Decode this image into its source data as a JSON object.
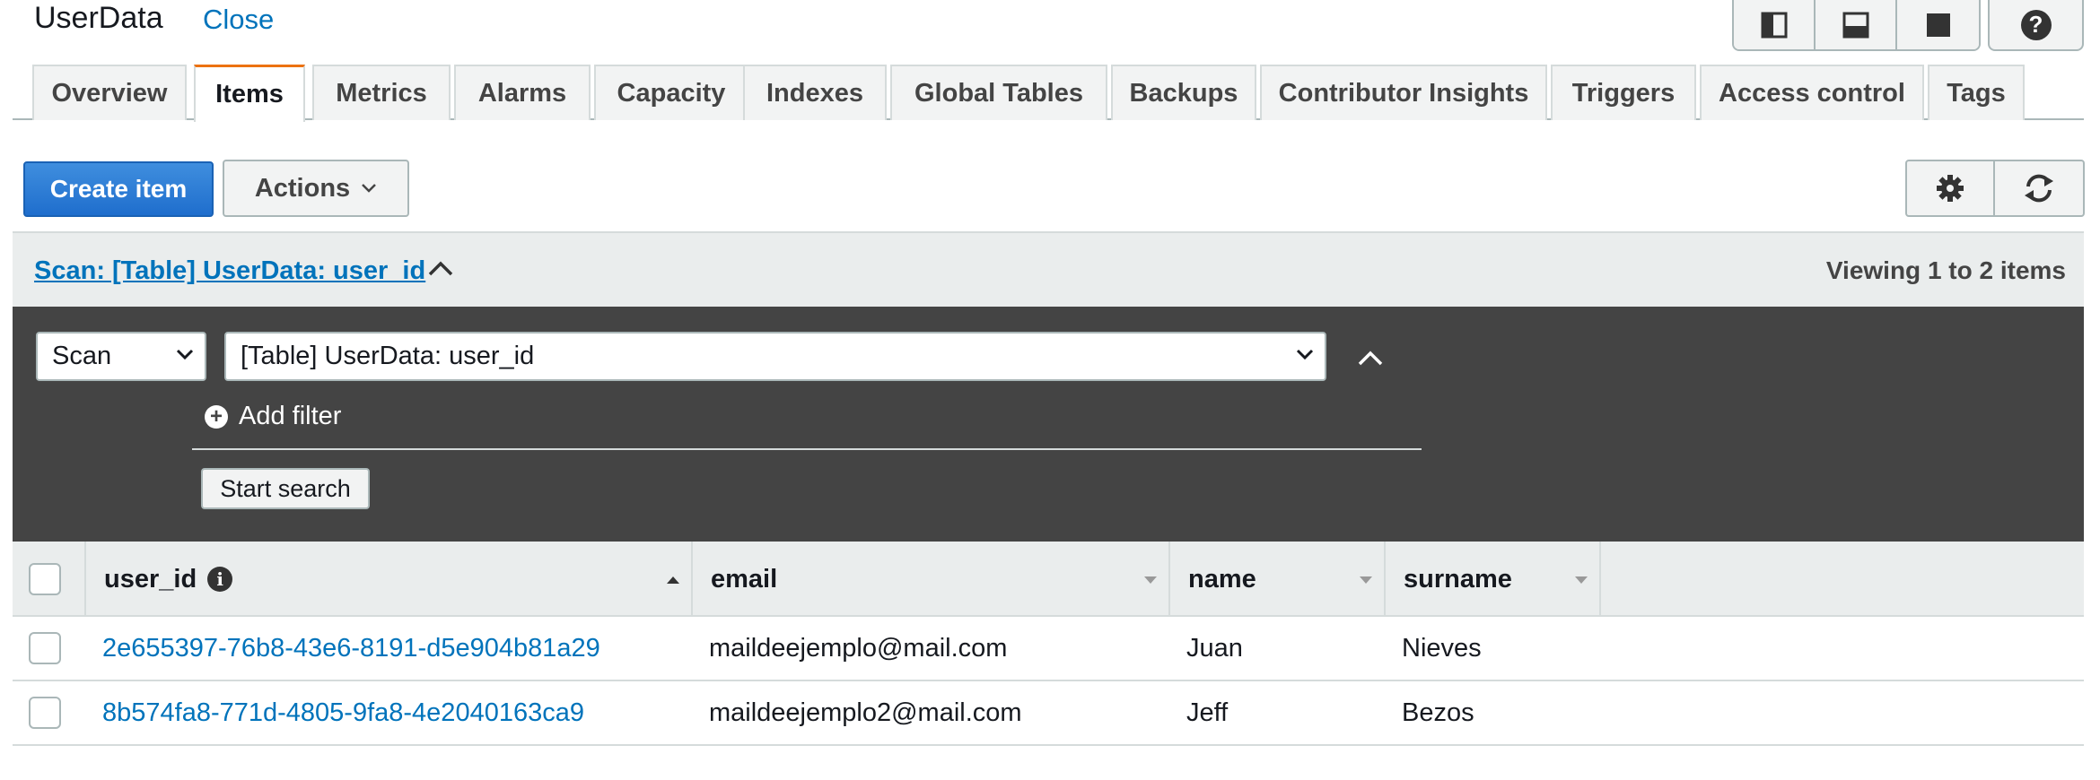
{
  "header": {
    "title": "UserData",
    "close_label": "Close",
    "layout_icons": [
      "layout-split-vertical-icon",
      "layout-split-horizontal-icon",
      "layout-full-icon"
    ],
    "help_icon": "help-icon"
  },
  "tabs": [
    {
      "label": "Overview",
      "active": false
    },
    {
      "label": "Items",
      "active": true
    },
    {
      "label": "Metrics",
      "active": false
    },
    {
      "label": "Alarms",
      "active": false
    },
    {
      "label": "Capacity",
      "active": false
    },
    {
      "label": "Indexes",
      "active": false
    },
    {
      "label": "Global Tables",
      "active": false
    },
    {
      "label": "Backups",
      "active": false
    },
    {
      "label": "Contributor Insights",
      "active": false
    },
    {
      "label": "Triggers",
      "active": false
    },
    {
      "label": "Access control",
      "active": false
    },
    {
      "label": "Tags",
      "active": false
    }
  ],
  "toolbar": {
    "create_label": "Create item",
    "actions_label": "Actions",
    "settings_icon": "gear-icon",
    "refresh_icon": "refresh-icon"
  },
  "scan": {
    "summary_link": "Scan: [Table] UserData: user_id",
    "viewing": "Viewing 1 to 2 items",
    "mode_value": "Scan",
    "target_value": "[Table] UserData: user_id",
    "add_filter_label": "Add filter",
    "start_search_label": "Start search"
  },
  "table": {
    "columns": [
      "user_id",
      "email",
      "name",
      "surname"
    ],
    "rows": [
      {
        "user_id": "2e655397-76b8-43e6-8191-d5e904b81a29",
        "email": "maildeejemplo@mail.com",
        "name": "Juan",
        "surname": "Nieves"
      },
      {
        "user_id": "8b574fa8-771d-4805-9fa8-4e2040163ca9",
        "email": "maildeejemplo2@mail.com",
        "name": "Jeff",
        "surname": "Bezos"
      }
    ]
  },
  "colors": {
    "accent": "#0073bb",
    "primary_button": "#1f6ecd",
    "active_tab": "#ec7211",
    "scan_panel": "#444444"
  }
}
